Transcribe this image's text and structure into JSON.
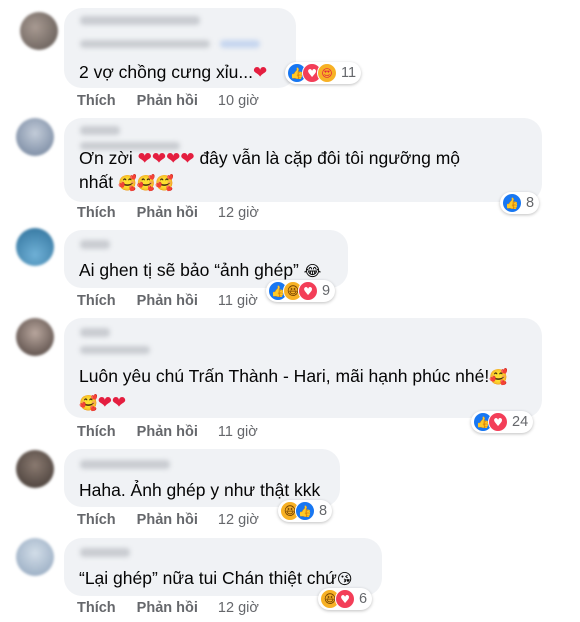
{
  "actions": {
    "like": "Thích",
    "reply": "Phản hồi"
  },
  "comments": [
    {
      "text": "2 vợ chồng cưng xỉu...",
      "time": "10 giờ",
      "reaction_count": "11",
      "reactions": [
        "like",
        "love",
        "care"
      ]
    },
    {
      "text_line1": "Ơn zời",
      "text_line1b": "đây vẫn là cặp đôi tôi ngưỡng mộ",
      "text_line2": "nhất",
      "time": "12 giờ",
      "reaction_count": "8",
      "reactions": [
        "like"
      ]
    },
    {
      "text": "Ai ghen tị sẽ bảo “ảnh ghép”",
      "time": "11 giờ",
      "reaction_count": "9",
      "reactions": [
        "like",
        "haha",
        "love"
      ]
    },
    {
      "text": "Luôn yêu chú Trấn Thành - Hari, mãi hạnh phúc nhé!",
      "time": "11 giờ",
      "reaction_count": "24",
      "reactions": [
        "like",
        "love"
      ]
    },
    {
      "text": "Haha. Ảnh ghép y như thật kkk",
      "time": "12 giờ",
      "reaction_count": "8",
      "reactions": [
        "haha",
        "like"
      ]
    },
    {
      "text": "“Lại ghép” nữa tui Chán thiệt chứ",
      "time": "12 giờ",
      "reaction_count": "6",
      "reactions": [
        "haha",
        "love"
      ]
    }
  ],
  "colors": {
    "bubble": "#f0f2f5",
    "meta": "#65676b",
    "like": "#1877f2",
    "love": "#f33e58",
    "haha": "#f7b125"
  },
  "icons": {
    "like": "thumbs-up-icon",
    "love": "heart-icon",
    "haha": "laughing-face-icon",
    "care": "hug-face-icon"
  }
}
